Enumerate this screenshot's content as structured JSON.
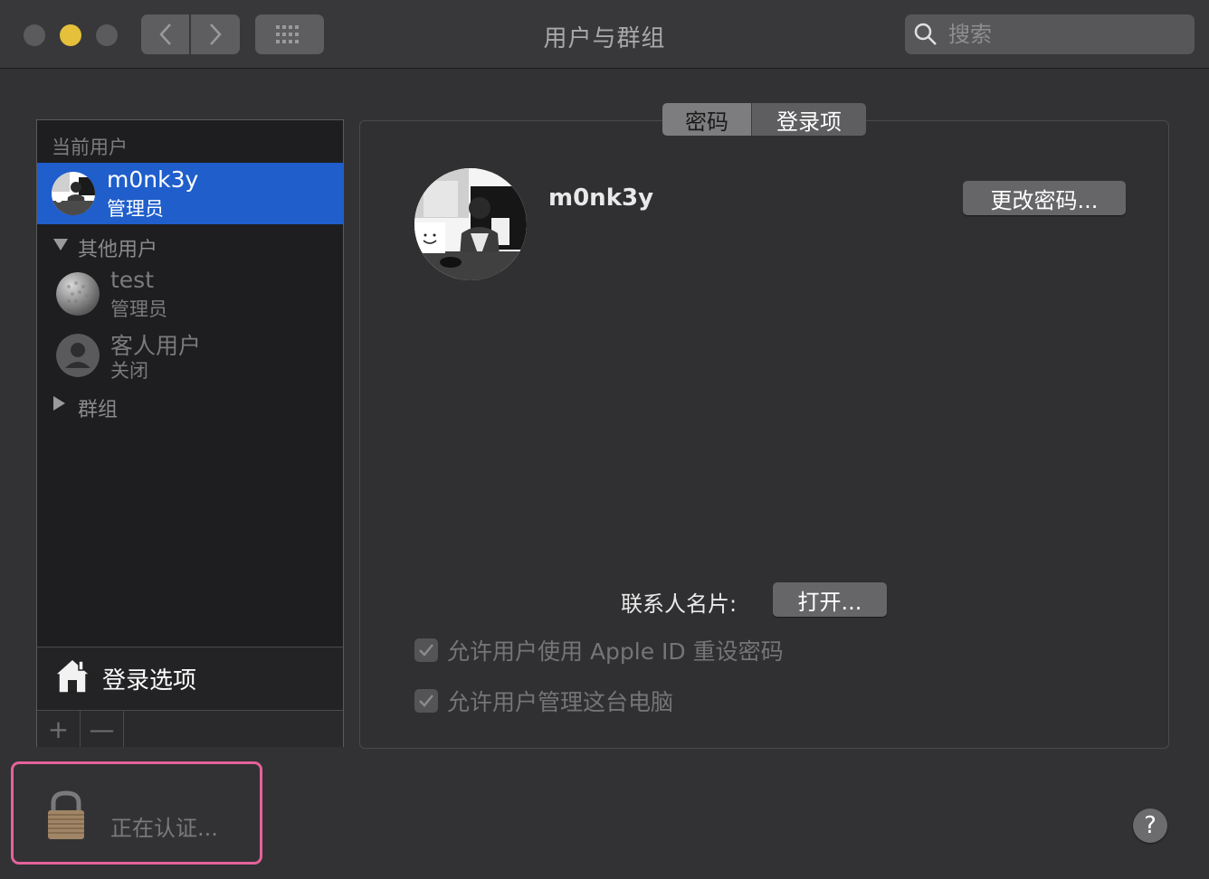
{
  "window": {
    "title": "用户与群组",
    "search_placeholder": "搜索"
  },
  "sidebar": {
    "current_users_header": "当前用户",
    "current_user": {
      "name": "m0nk3y",
      "role": "管理员"
    },
    "other_users_header": "其他用户",
    "other_users": [
      {
        "name": "test",
        "role": "管理员"
      },
      {
        "name": "客人用户",
        "role": "关闭"
      }
    ],
    "groups_label": "群组",
    "login_options_label": "登录选项",
    "add_label": "+",
    "remove_label": "—"
  },
  "tabs": [
    {
      "label": "密码",
      "active": true
    },
    {
      "label": "登录项",
      "active": false
    }
  ],
  "detail": {
    "user_name": "m0nk3y",
    "change_password_label": "更改密码...",
    "contact_card_label": "联系人名片:",
    "open_label": "打开...",
    "checkboxes": [
      {
        "label": "允许用户使用 Apple ID 重设密码",
        "checked": true
      },
      {
        "label": "允许用户管理这台电脑",
        "checked": true
      }
    ]
  },
  "lock": {
    "status_text": "正在认证..."
  },
  "help": {
    "label": "?"
  },
  "colors": {
    "accent": "#1f5ecb",
    "highlight": "#e4629a",
    "background": "#323234"
  }
}
